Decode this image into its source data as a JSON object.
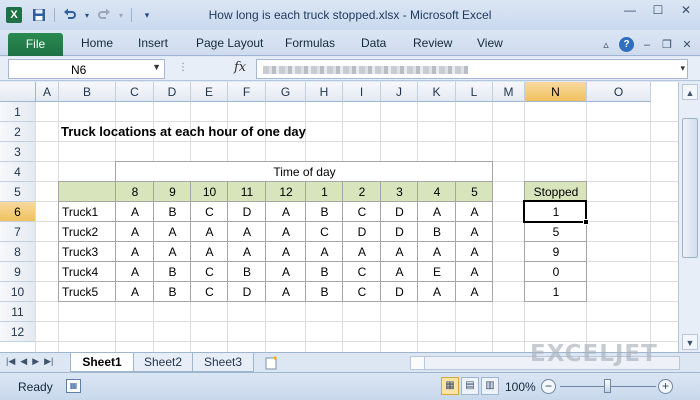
{
  "window": {
    "title": "How long is each truck stopped.xlsx - Microsoft Excel",
    "app_icon": "X",
    "qat_icons": [
      "save-icon",
      "undo-icon",
      "redo-icon",
      "customize-icon"
    ],
    "controls": [
      "minimize-icon",
      "maximize-icon",
      "close-icon"
    ]
  },
  "ribbon": {
    "file_tab": "File",
    "tabs": [
      "Home",
      "Insert",
      "Page Layout",
      "Formulas",
      "Data",
      "Review",
      "View"
    ]
  },
  "formula_bar": {
    "name_box": "N6",
    "fx": "fx",
    "formula": ""
  },
  "sheet": {
    "columns": [
      "A",
      "B",
      "C",
      "D",
      "E",
      "F",
      "G",
      "H",
      "I",
      "J",
      "K",
      "L",
      "M",
      "N",
      "O"
    ],
    "rows": [
      "1",
      "2",
      "3",
      "4",
      "5",
      "6",
      "7",
      "8",
      "9",
      "10",
      "11",
      "12"
    ],
    "selected_column": "N",
    "selected_row": "6",
    "title": "Truck locations at each hour of one day",
    "time_of_day_label": "Time of day",
    "hours": [
      "8",
      "9",
      "10",
      "11",
      "12",
      "1",
      "2",
      "3",
      "4",
      "5"
    ],
    "trucks": [
      {
        "name": "Truck1",
        "locations": [
          "A",
          "B",
          "C",
          "D",
          "A",
          "B",
          "C",
          "D",
          "A",
          "A"
        ],
        "stopped": "1"
      },
      {
        "name": "Truck2",
        "locations": [
          "A",
          "A",
          "A",
          "A",
          "A",
          "C",
          "D",
          "D",
          "B",
          "A"
        ],
        "stopped": "5"
      },
      {
        "name": "Truck3",
        "locations": [
          "A",
          "A",
          "A",
          "A",
          "A",
          "A",
          "A",
          "A",
          "A",
          "A"
        ],
        "stopped": "9"
      },
      {
        "name": "Truck4",
        "locations": [
          "A",
          "B",
          "C",
          "B",
          "A",
          "B",
          "C",
          "A",
          "E",
          "A"
        ],
        "stopped": "0"
      },
      {
        "name": "Truck5",
        "locations": [
          "A",
          "B",
          "C",
          "D",
          "A",
          "B",
          "C",
          "D",
          "A",
          "A"
        ],
        "stopped": "1"
      }
    ],
    "stopped_header": "Stopped",
    "highlight_color": "#d8e4bc"
  },
  "sheet_tabs": [
    "Sheet1",
    "Sheet2",
    "Sheet3"
  ],
  "watermark": "EXCELJET",
  "status_bar": {
    "ready": "Ready",
    "zoom": "100%"
  }
}
